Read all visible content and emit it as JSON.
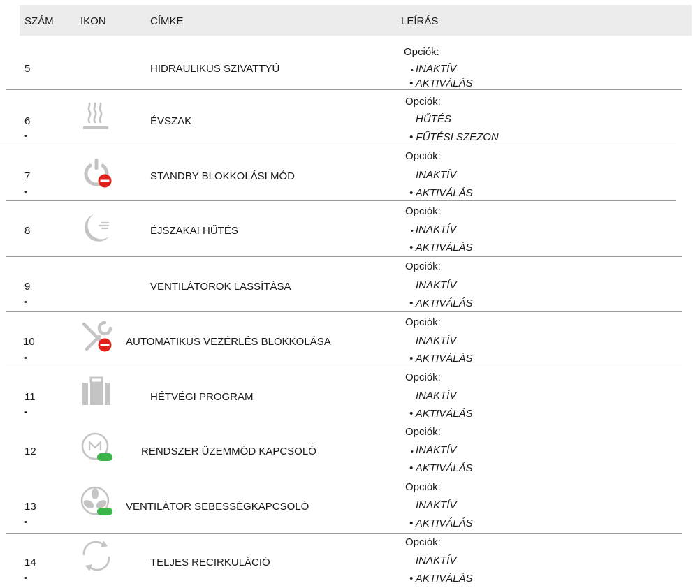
{
  "headers": {
    "num": "SZÁM",
    "icon": "IKON",
    "label": "CÍMKE",
    "desc": "LEÍRÁS"
  },
  "rows": [
    {
      "num": "5",
      "label": "HIDRAULIKUS SZIVATTYÚ",
      "icon": "none",
      "options_title": "Opciók:",
      "opt1": "INAKTÍV",
      "opt2": "AKTIVÁLÁS",
      "opt3": ""
    },
    {
      "num": "6",
      "label": "ÉVSZAK",
      "icon": "heat-waves-icon",
      "options_title": "Opciók:",
      "opt1": "HŰTÉS",
      "opt2": "",
      "opt3": "FŰTÉSI SZEZON"
    },
    {
      "num": "7",
      "label": "STANDBY BLOKKOLÁSI MÓD",
      "icon": "standby-block-icon",
      "options_title": "Opciók:",
      "opt1": "INAKTÍV",
      "opt2": "AKTIVÁLÁS",
      "opt3": ""
    },
    {
      "num": "8",
      "label": "ÉJSZAKAI HŰTÉS",
      "icon": "night-cooling-icon",
      "options_title": "Opciók:",
      "opt1": "INAKTÍV",
      "opt2": "AKTIVÁLÁS",
      "opt3": ""
    },
    {
      "num": "9",
      "label": "VENTILÁTOROK LASSÍTÁSA",
      "icon": "none",
      "options_title": "Opciók:",
      "opt1": "INAKTÍV",
      "opt2": "AKTIVÁLÁS",
      "opt3": ""
    },
    {
      "num": "10",
      "label": "AUTOMATIKUS VEZÉRLÉS BLOKKOLÁSA",
      "icon": "tools-block-icon",
      "options_title": "Opciók:",
      "opt1": "INAKTÍV",
      "opt2": "AKTIVÁLÁS",
      "opt3": ""
    },
    {
      "num": "11",
      "label": "HÉTVÉGI PROGRAM",
      "icon": "suitcase-icon",
      "options_title": "Opciók:",
      "opt1": "INAKTÍV",
      "opt2": "AKTIVÁLÁS",
      "opt3": ""
    },
    {
      "num": "12",
      "label": "RENDSZER ÜZEMMÓD KAPCSOLÓ",
      "icon": "mode-switch-icon",
      "options_title": "Opciók:",
      "opt1": "INAKTÍV",
      "opt2": "AKTIVÁLÁS",
      "opt3": ""
    },
    {
      "num": "13",
      "label": "VENTILÁTOR SEBESSÉGKAPCSOLÓ",
      "icon": "fan-speed-icon",
      "options_title": "Opciók:",
      "opt1": "INAKTÍV",
      "opt2": "AKTIVÁLÁS",
      "opt3": ""
    },
    {
      "num": "14",
      "label": "TELJES RECIRKULÁCIÓ",
      "icon": "recirculation-icon",
      "options_title": "Opciók:",
      "opt1": "INAKTÍV",
      "opt2": "AKTIVÁLÁS",
      "opt3": ""
    }
  ],
  "colors": {
    "header_bg": "#ececec",
    "icon_gray": "#c4c4c4",
    "stop_red": "#e0201b",
    "toggle_green": "#3bb54a"
  }
}
